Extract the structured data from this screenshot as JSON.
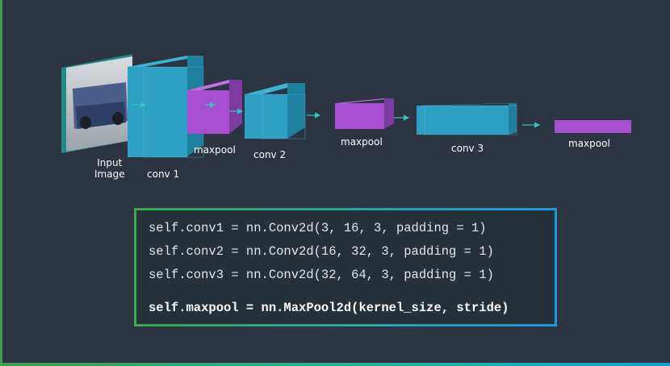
{
  "labels": {
    "input_image_line1": "Input",
    "input_image_line2": "Image",
    "conv1": "conv 1",
    "maxpool1": "maxpool",
    "conv2": "conv 2",
    "maxpool2": "maxpool",
    "conv3": "conv 3",
    "maxpool3": "maxpool"
  },
  "colors": {
    "background": "#2b3440",
    "conv": "#2f9fc4",
    "maxpool": "#a64fd0",
    "frame_green": "#3aa04a",
    "frame_blue": "#1a9ad8",
    "arrow": "#35c3c0"
  },
  "code": {
    "line1": "self.conv1 = nn.Conv2d(3, 16, 3, padding = 1)",
    "line2": "self.conv2 = nn.Conv2d(16, 32, 3, padding = 1)",
    "line3": "self.conv3 = nn.Conv2d(32, 64, 3, padding = 1)",
    "line4": "self.maxpool = nn.MaxPool2d(kernel_size, stride)"
  }
}
